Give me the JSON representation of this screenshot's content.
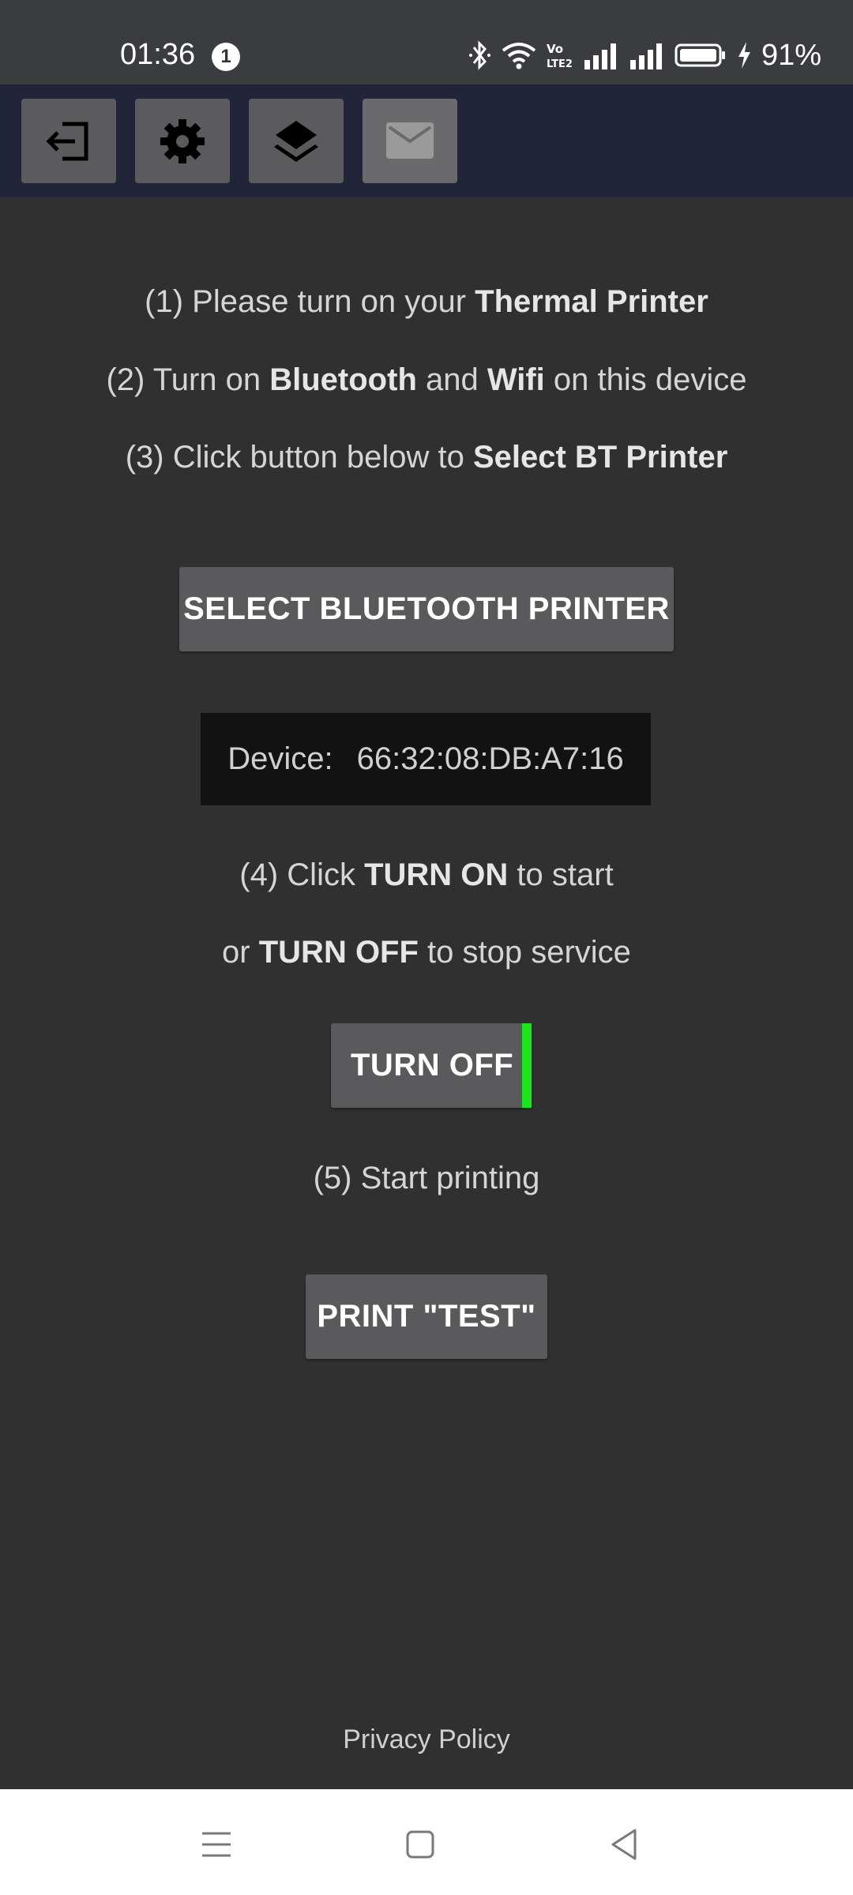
{
  "status_bar": {
    "time": "01:36",
    "notification_count": "1",
    "battery_percent": "91%",
    "icons": [
      "bluetooth-icon",
      "wifi-icon",
      "volte-icon",
      "signal-icon",
      "signal-icon",
      "battery-icon",
      "charging-icon"
    ]
  },
  "toolbar": {
    "buttons": [
      {
        "icon": "logout-icon"
      },
      {
        "icon": "gear-icon"
      },
      {
        "icon": "layers-icon"
      },
      {
        "icon": "mail-icon",
        "disabled": true
      }
    ]
  },
  "instructions": {
    "step1_prefix": "(1) Please turn on your ",
    "step1_bold": "Thermal Printer",
    "step2_prefix": "(2) Turn on ",
    "step2_bold1": "Bluetooth",
    "step2_mid": " and ",
    "step2_bold2": "Wifi",
    "step2_suffix": " on this device",
    "step3_prefix": "(3) Click button below to ",
    "step3_bold": "Select BT Printer",
    "step4_prefix": "(4) Click ",
    "step4_bold": "TURN ON",
    "step4_suffix": " to start",
    "step4b_prefix": "or ",
    "step4b_bold": "TURN OFF",
    "step4b_suffix": " to stop service",
    "step5": "(5) Start printing"
  },
  "select_printer_button": "SELECT BLUETOOTH PRINTER",
  "device": {
    "label": "Device:",
    "address": "66:32:08:DB:A7:16"
  },
  "service_toggle": {
    "label": "TURN OFF",
    "indicator_color": "#18e718",
    "state": "on"
  },
  "print_test_button": "PRINT \"TEST\"",
  "privacy_policy_link": "Privacy Policy",
  "colors": {
    "background": "#303030",
    "toolbar": "#222539",
    "button": "#5a5a5c",
    "device_box": "#121212"
  }
}
